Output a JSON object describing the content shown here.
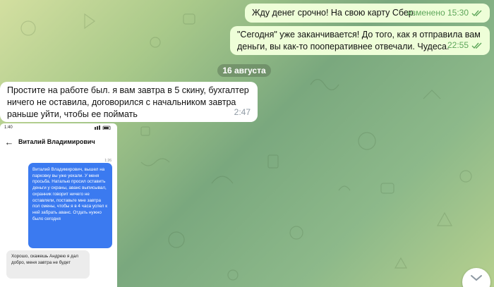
{
  "messages": [
    {
      "text": "Жду денег срочно! На свою карту Сбер.",
      "meta": "изменено 15:30"
    },
    {
      "text": "\"Сегодня\" уже заканчивается! До того, как я отправила вам деньги, вы как-то пооперативнее отвечали. Чудесa.",
      "meta": "22:55"
    },
    {
      "text": "Простите на работе был. я вам завтра в 5 скину, бухгалтер ничего не оставила, договорился с начальником завтра раньше уйти, чтобы ее поймать",
      "meta": "2:47"
    }
  ],
  "date_divider": "16 августа",
  "phone": {
    "status_time": "1:40",
    "contact_name": "Виталий Владимирович",
    "msg_time": "1:26",
    "sent_text": "Виталий Владимирович, вышел на парковку вы уже уехали. У меня просьба. Наталью просил оставить деньги у охраны, аванс выписывал, охранник говорит ничего не оставляли, поставьте мне завтра пол смены, чтобы я в 4 часа успел к ней забрать аванс. Отдать нужно было сегодня",
    "received_text": "Хорошо, скажешь Андрею я дал добро, меня завтра не будет"
  },
  "icons": {
    "read": "double-check-icon",
    "back": "arrow-left-icon",
    "scroll": "chevron-down-icon"
  },
  "colors": {
    "outgoing": "#eefed8",
    "incoming": "#ffffff",
    "meta_out": "#5ea65a",
    "phone_bubble": "#3b7af0"
  }
}
